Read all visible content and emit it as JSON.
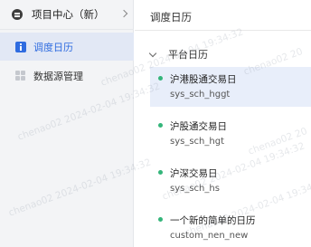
{
  "sidebar": {
    "project_title": "项目中心（新）",
    "items": [
      {
        "label": "调度日历",
        "icon": "calendar-icon",
        "active": true
      },
      {
        "label": "数据源管理",
        "icon": "datasource-icon",
        "active": false
      }
    ]
  },
  "main": {
    "title": "调度日历",
    "group": {
      "label": "平台日历",
      "calendars": [
        {
          "name": "沪港股通交易日",
          "code": "sys_sch_hggt",
          "selected": true
        },
        {
          "name": "沪股通交易日",
          "code": "sys_sch_hgt",
          "selected": false
        },
        {
          "name": "沪深交易日",
          "code": "sys_sch_hs",
          "selected": false
        },
        {
          "name": "一个新的简单的日历",
          "code": "custom_nen_new",
          "selected": false
        }
      ]
    }
  },
  "watermark": {
    "texts": [
      "chenao02 2024-02-04 19:34:32",
      "chenao02 2024-02-04 19:34:32",
      "chenao02 2024-02-04 19:34:32",
      "chenao02 20",
      "chenao02 20",
      "chenao02 2024-02-04 19:34:32",
      "chenao02 2024-02-04 19:34:32"
    ]
  },
  "colors": {
    "accent": "#2f6ce0",
    "status_dot": "#34b57a",
    "sidebar_bg": "#f3f4f6",
    "active_bg": "#e2e8f5"
  }
}
